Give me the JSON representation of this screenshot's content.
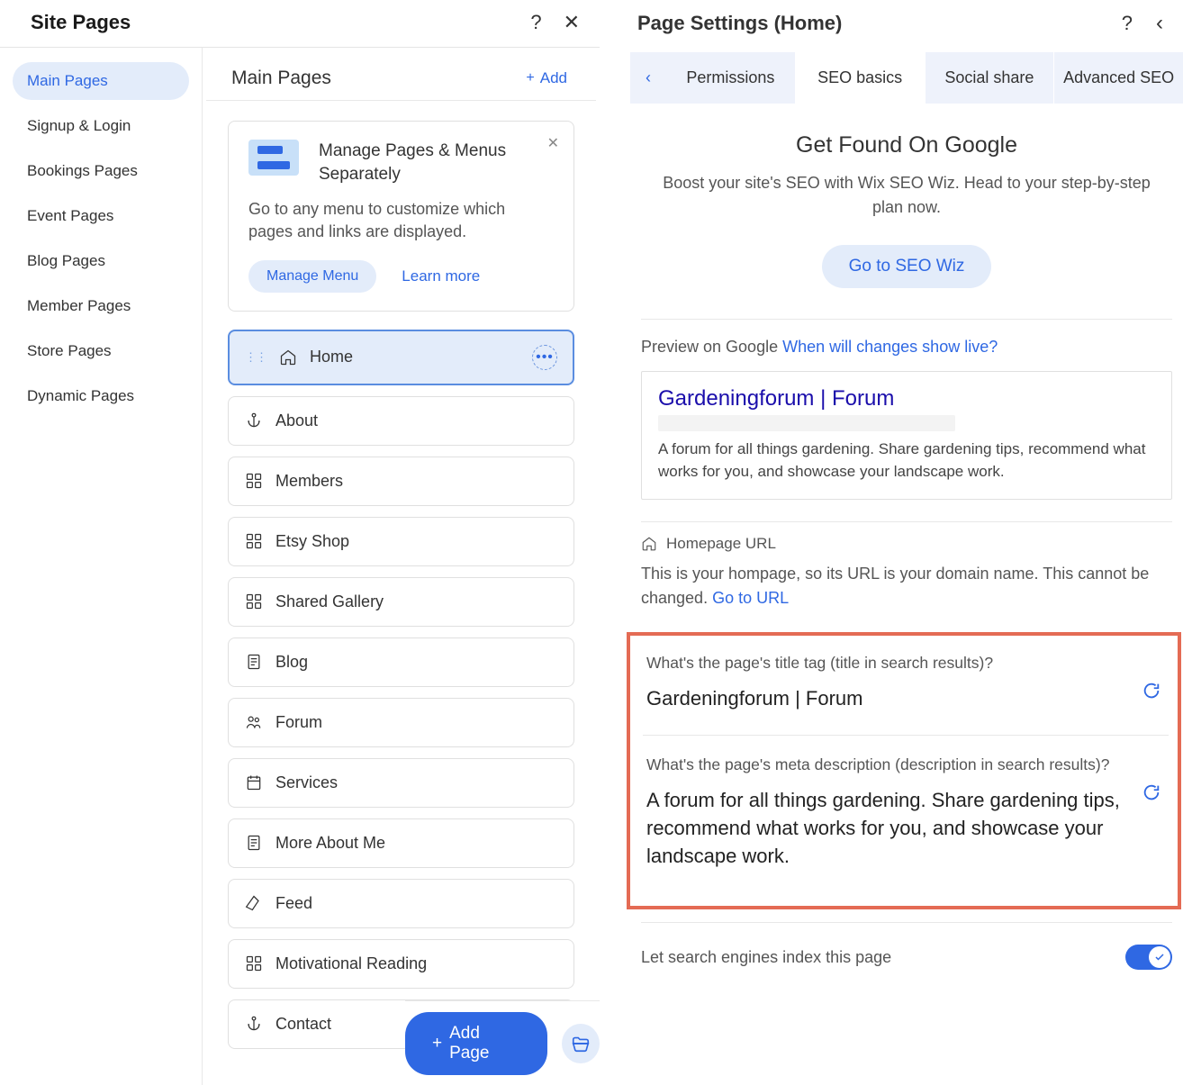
{
  "left": {
    "title": "Site Pages",
    "sidebar": [
      {
        "label": "Main Pages",
        "active": true
      },
      {
        "label": "Signup & Login"
      },
      {
        "label": "Bookings Pages"
      },
      {
        "label": "Event Pages"
      },
      {
        "label": "Blog Pages"
      },
      {
        "label": "Member Pages"
      },
      {
        "label": "Store Pages"
      },
      {
        "label": "Dynamic Pages"
      }
    ],
    "pages_head": "Main Pages",
    "add_label": "Add",
    "info": {
      "title": "Manage Pages & Menus Separately",
      "desc": "Go to any menu to customize which pages and links are displayed.",
      "manage_btn": "Manage Menu",
      "learn_link": "Learn more"
    },
    "pages": [
      {
        "label": "Home",
        "icon": "home",
        "selected": true
      },
      {
        "label": "About",
        "icon": "anchor"
      },
      {
        "label": "Members",
        "icon": "grid"
      },
      {
        "label": "Etsy Shop",
        "icon": "grid"
      },
      {
        "label": "Shared Gallery",
        "icon": "grid"
      },
      {
        "label": "Blog",
        "icon": "page"
      },
      {
        "label": "Forum",
        "icon": "people"
      },
      {
        "label": "Services",
        "icon": "calendar"
      },
      {
        "label": "More About Me",
        "icon": "page"
      },
      {
        "label": "Feed",
        "icon": "pen"
      },
      {
        "label": "Motivational Reading",
        "icon": "grid"
      },
      {
        "label": "Contact",
        "icon": "anchor"
      }
    ],
    "add_page_btn": "Add Page"
  },
  "right": {
    "title": "Page Settings (Home)",
    "tabs": [
      {
        "label": "Permissions"
      },
      {
        "label": "SEO basics",
        "active": true
      },
      {
        "label": "Social share"
      },
      {
        "label": "Advanced SEO"
      }
    ],
    "hero": {
      "title": "Get Found On Google",
      "desc": "Boost your site's SEO with Wix SEO Wiz. Head to your step-by-step plan now.",
      "btn": "Go to SEO Wiz"
    },
    "preview": {
      "label": "Preview on Google",
      "live_link": "When will changes show live?",
      "title": "Gardeningforum | Forum",
      "desc": "A forum for all things gardening. Share gardening tips, recommend what works for you, and showcase your landscape work."
    },
    "url": {
      "head": "Homepage URL",
      "desc_pre": "This is your hompage, so its URL is your domain name. This cannot be changed. ",
      "link": "Go to URL"
    },
    "fields": {
      "title_label": "What's the page's title tag (title in search results)?",
      "title_value": "Gardeningforum | Forum",
      "desc_label": "What's the page's meta description (description in search results)?",
      "desc_value": "A forum for all things gardening. Share gardening tips, recommend what works for you, and showcase your landscape work."
    },
    "index_label": "Let search engines index this page"
  }
}
